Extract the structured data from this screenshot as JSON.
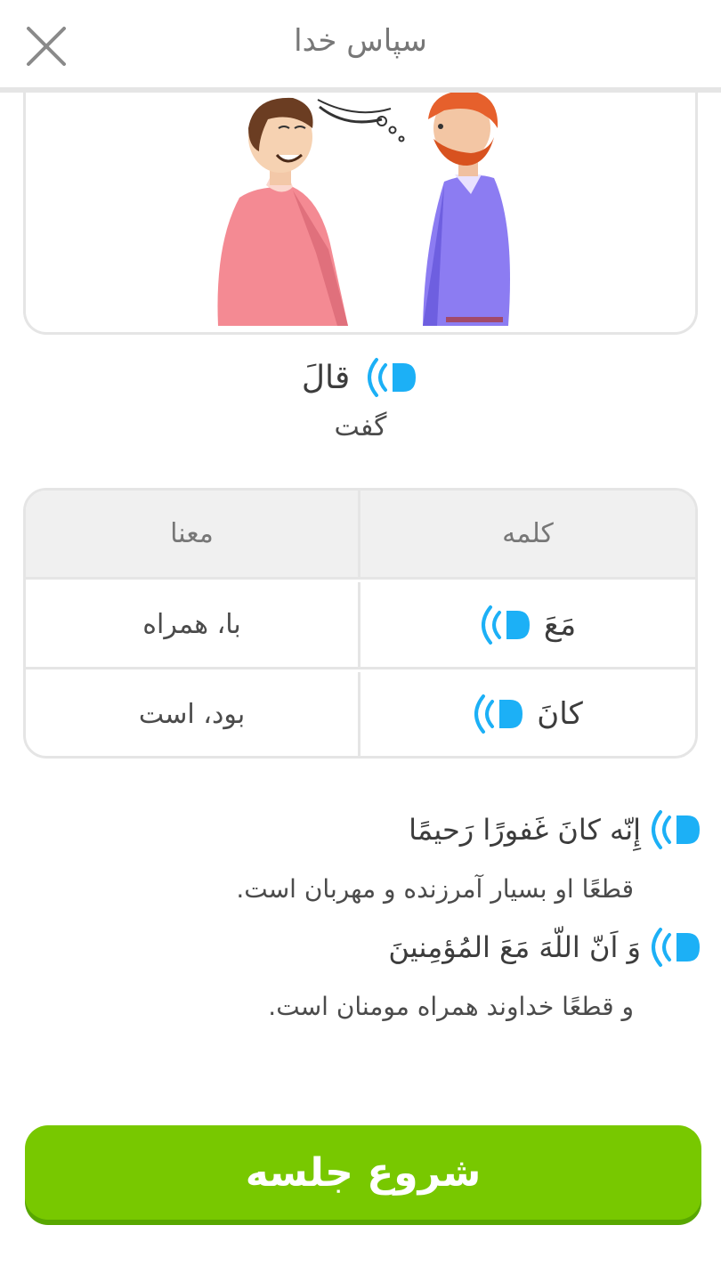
{
  "header": {
    "title": "سپاس خدا",
    "close_icon": "close-icon"
  },
  "lesson": {
    "word": "قالَ",
    "meaning": "گفت"
  },
  "vocab_table": {
    "headers": {
      "word": "کلمه",
      "meaning": "معنا"
    },
    "rows": [
      {
        "word": "مَعَ",
        "meaning": "با، همراه"
      },
      {
        "word": "کانَ",
        "meaning": "بود، است"
      }
    ]
  },
  "verses": [
    {
      "arabic": "إِنّه كانَ غَفورًا رَحيمًا",
      "translation": "قطعًا او بسیار آمرزنده و مهربان است."
    },
    {
      "arabic": "وَ اَنّ اللّهَ مَعَ المُؤمِنينَ",
      "translation": "و قطعًا خداوند همراه مومنان است."
    }
  ],
  "footer": {
    "start_label": "شروع جلسه"
  },
  "colors": {
    "accent_blue": "#1cb0f6",
    "button_green": "#78c800",
    "button_shadow": "#58a700",
    "border_gray": "#e5e5e5"
  },
  "icons": [
    "close-icon",
    "speaker-icon"
  ]
}
